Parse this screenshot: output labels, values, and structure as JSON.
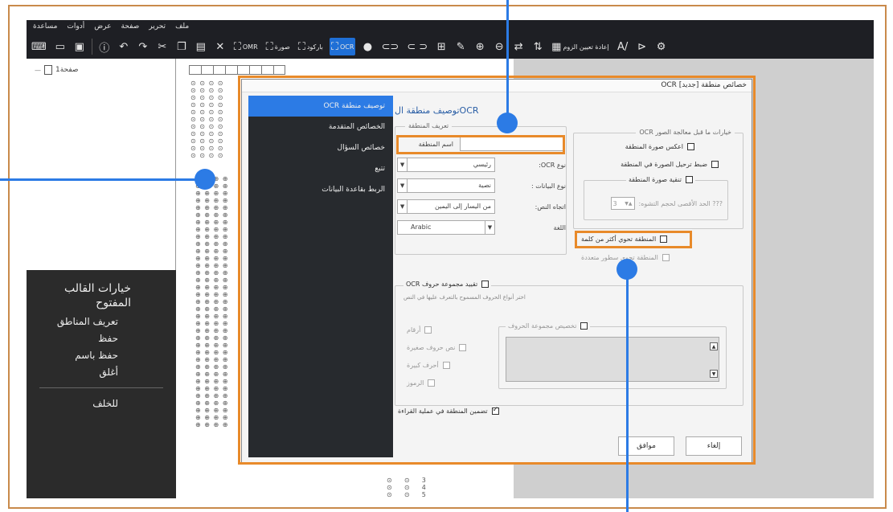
{
  "menubar": {
    "items": [
      "ملف",
      "تحرير",
      "صفحة",
      "عرض",
      "أدوات",
      "مساعدة"
    ]
  },
  "toolbar": {
    "omr_label": "OMR",
    "image_label": "صورة",
    "barcode_label": "باركود",
    "ocr_label": "OCR",
    "reset_zoom_label": "إعادة تعيين الزوم"
  },
  "tree": {
    "page_label": "1صفحة"
  },
  "leftnav": {
    "heading": "خيارات القالب المفتوح",
    "items": [
      "تعريف المناطق",
      "حفظ",
      "حفظ باسم",
      "أغلق"
    ],
    "back": "للخلف"
  },
  "dialog": {
    "title": "خصائص منطقة [جديد] OCR",
    "nav": [
      "توصيف منطقة OCR",
      "الخصائص المتقدمة",
      "خصائص السؤال",
      "تتبع",
      "الربط بقاعدة البيانات"
    ],
    "pane_title": "توصيف منطقة الOCR",
    "zone_group": {
      "title": "تعريف المنطقة",
      "name_label": "اسم المنطقة",
      "name_value": "",
      "ocr_type_label": "نوع OCR:",
      "ocr_type_value": "رئيسي",
      "data_type_label": "نوع البيانات :",
      "data_type_value": "نصية",
      "text_direction_label": "اتجاه النص:",
      "text_direction_value": "من اليسار إلى اليمين",
      "language_label": "اللغة",
      "language_value": "Arabic"
    },
    "preprocess_group": {
      "title": "OCR خيارات ما قبل معالجة الصور",
      "invert": "اعكس صورة المنطقة",
      "deskew": "ضبط ترحيل الصورة في المنطقة",
      "clean": "تنقية صورة المنطقة",
      "max_size_label": "??? الحد الأقصى لحجم التشوه:",
      "max_size_value": "3"
    },
    "multi_word": "المنطقة تحوي أكثر من كلمة",
    "multi_line": "المنطقة تحوي سطور متعددة",
    "charset_group": {
      "title": "تقييد مجموعة حروف OCR",
      "hint": "اختر أنواع الحروف المسموح بالتعرف عليها في النص",
      "options": [
        "أرقام",
        "نص حروف صغيرة",
        "أحرف كبيرة",
        "الرموز"
      ],
      "custom_title": "تخصيص مجموعة الحروف"
    },
    "include_in_read": "تضمين المنطقة في عملية القراءة",
    "ok": "موافق",
    "cancel": "إلغاء"
  },
  "colors": {
    "accent": "#2c7be5",
    "highlight": "#e88a2a",
    "frame": "#c98a4b"
  }
}
